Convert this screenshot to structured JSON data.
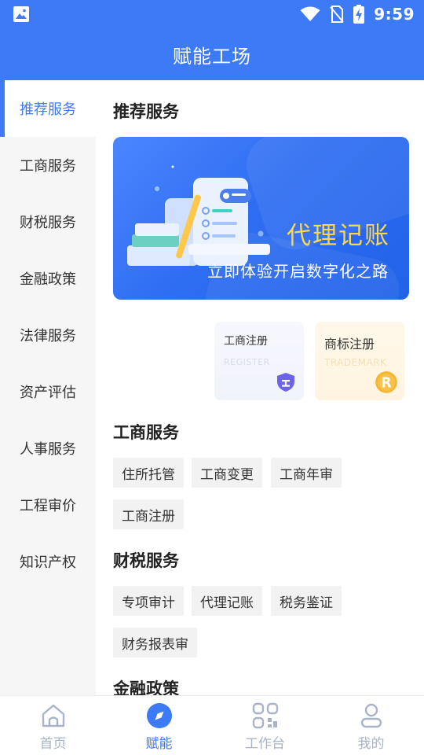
{
  "status_bar": {
    "time": "9:59"
  },
  "app_bar": {
    "title": "赋能工场"
  },
  "sidebar": {
    "items": [
      {
        "label": "推荐服务",
        "active": true
      },
      {
        "label": "工商服务"
      },
      {
        "label": "财税服务"
      },
      {
        "label": "金融政策"
      },
      {
        "label": "法律服务"
      },
      {
        "label": "资产评估"
      },
      {
        "label": "人事服务"
      },
      {
        "label": "工程审价"
      },
      {
        "label": "知识产权"
      }
    ]
  },
  "main": {
    "recommend_title": "推荐服务",
    "banner": {
      "title": "代理记账",
      "subtitle": "立即体验开启数字化之路"
    },
    "cards": [
      {
        "title": "工商注册",
        "subtitle": "REGISTER",
        "icon": "shield-icon"
      },
      {
        "title": "商标注册",
        "subtitle": "TRADEMARK",
        "icon": "registered-trademark-icon"
      }
    ],
    "sections": [
      {
        "title": "工商服务",
        "tags": [
          "住所托管",
          "工商变更",
          "工商年审",
          "工商注册"
        ]
      },
      {
        "title": "财税服务",
        "tags": [
          "专项审计",
          "代理记账",
          "税务鉴证",
          "财务报表审"
        ]
      },
      {
        "title": "金融政策",
        "tags": []
      }
    ]
  },
  "bottom_nav": {
    "items": [
      {
        "label": "首页",
        "icon": "home-icon"
      },
      {
        "label": "赋能",
        "icon": "compass-icon",
        "active": true
      },
      {
        "label": "工作台",
        "icon": "workbench-icon"
      },
      {
        "label": "我的",
        "icon": "profile-icon"
      }
    ]
  },
  "colors": {
    "primary": "#3d7af6",
    "banner_title": "#ffd84a",
    "tag_bg": "#f2f2f2",
    "sidebar_bg": "#f6f6f6"
  }
}
